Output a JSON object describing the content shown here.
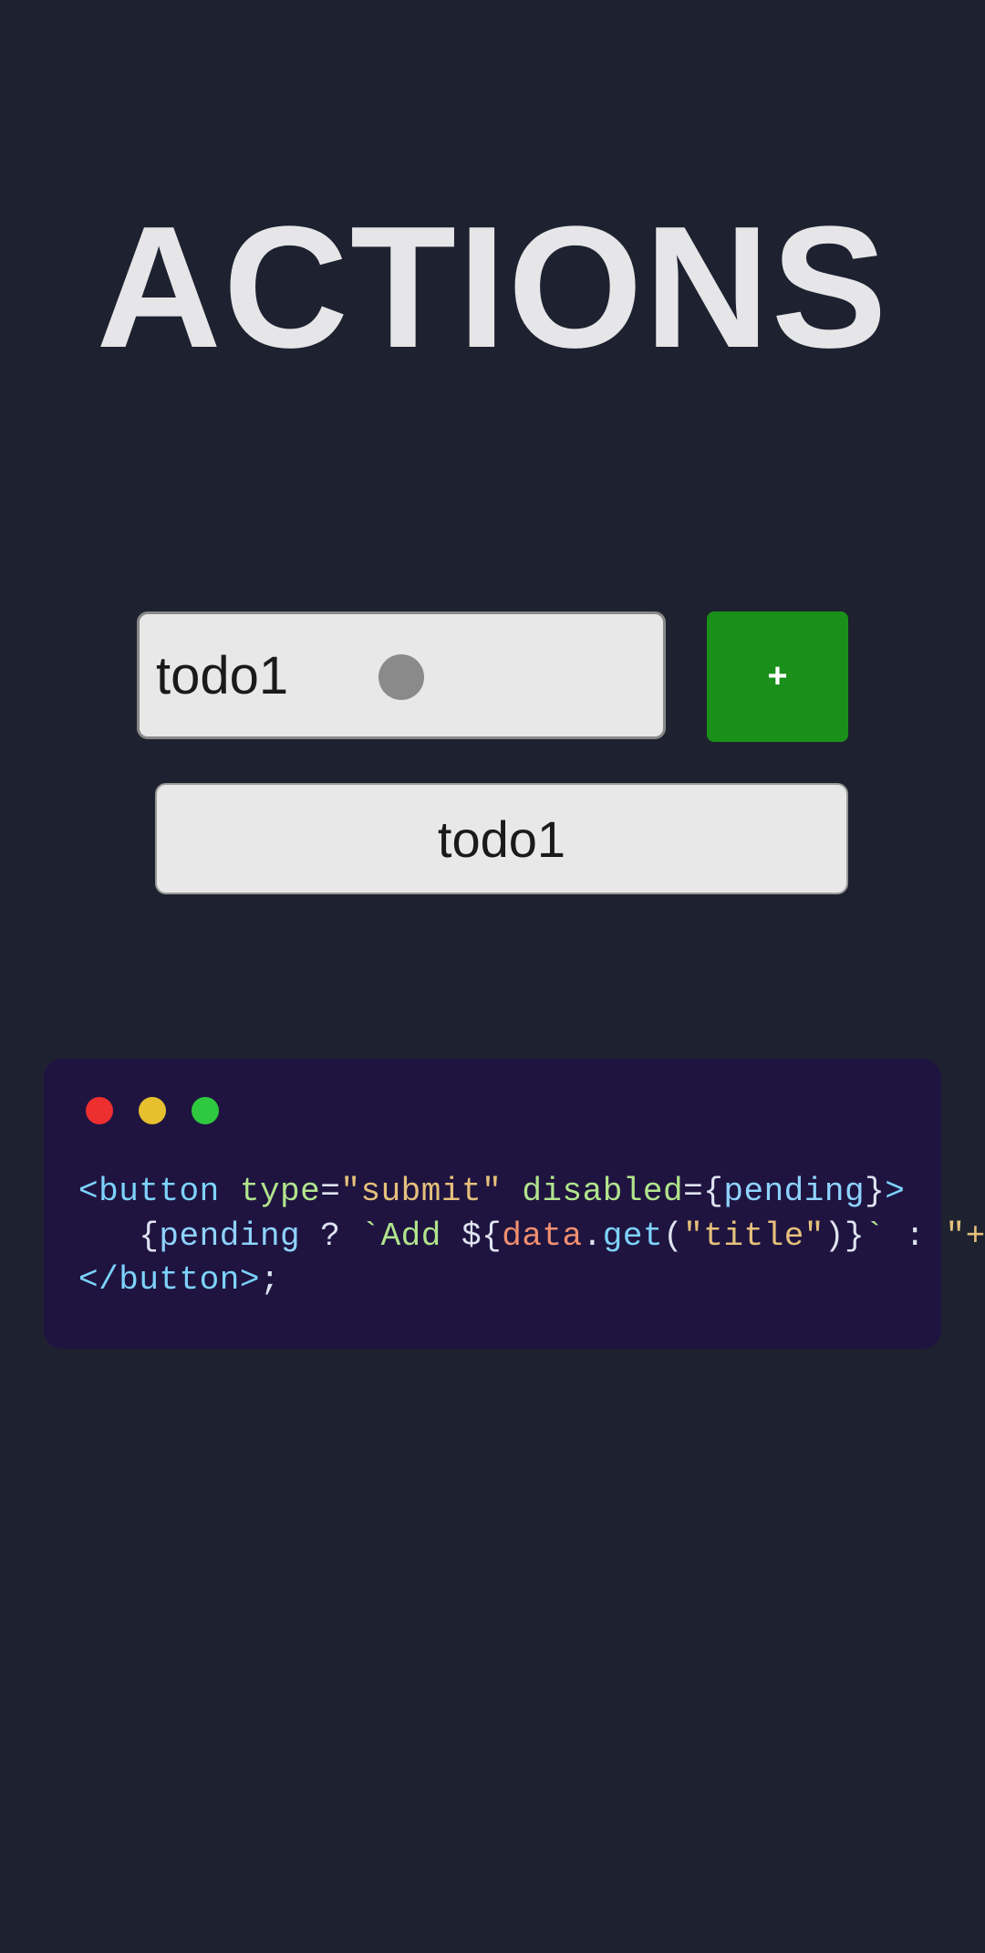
{
  "heading": "ACTIONS",
  "form": {
    "input_value": "todo1",
    "add_button_label": "+"
  },
  "todos": [
    {
      "title": "todo1"
    }
  ],
  "code": {
    "traffic_lights": [
      "red",
      "yellow",
      "green"
    ],
    "line1": {
      "tag_open": "<",
      "tag_name": "button",
      "attr1_name": "type",
      "attr1_value": "\"submit\"",
      "attr2_name": "disabled",
      "attr2_lbrace": "{",
      "attr2_expr": "pending",
      "attr2_rbrace": "}",
      "tag_close": ">"
    },
    "line2": {
      "indent": "   ",
      "lbrace": "{",
      "cond": "pending",
      "qmark": " ? ",
      "tmpl_open": "`",
      "tmpl_text": "Add ",
      "interp_open": "${",
      "obj": "data",
      "dot": ".",
      "method": "get",
      "paren_open": "(",
      "arg": "\"title\"",
      "paren_close": ")",
      "interp_close": "}",
      "tmpl_close": "`",
      "colon": " : ",
      "alt": "\"+\"",
      "rbrace": "}"
    },
    "line3": {
      "close_open": "</",
      "tag_name": "button",
      "close_close": ">",
      "semicolon": ";"
    }
  }
}
